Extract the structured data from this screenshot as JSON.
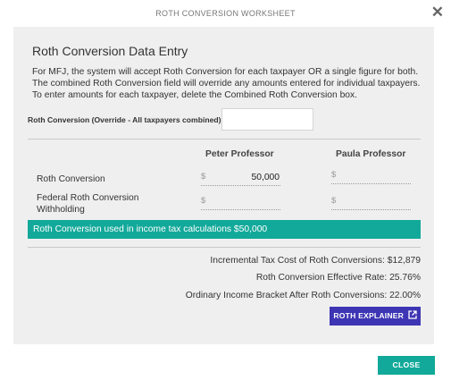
{
  "dialog": {
    "title": "ROTH CONVERSION WORKSHEET",
    "close_icon": "close-icon"
  },
  "panel": {
    "title": "Roth Conversion Data Entry",
    "description": "For MFJ, the system will accept Roth Conversion for each taxpayer OR a single figure for both. The combined Roth Conversion field will override any amounts entered for individual taxpayers. To enter amounts for each taxpayer, delete the Combined Roth Conversion box."
  },
  "override": {
    "label": "Roth Conversion (Override - All taxpayers combined)",
    "value": ""
  },
  "columns": {
    "taxpayer1": "Peter Professor",
    "taxpayer2": "Paula Professor"
  },
  "rows": [
    {
      "label": "Roth Conversion",
      "currency": "$",
      "taxpayer1_value": "50,000",
      "taxpayer2_value": ""
    },
    {
      "label": "Federal Roth Conversion Withholding",
      "currency": "$",
      "taxpayer1_value": "",
      "taxpayer2_value": ""
    }
  ],
  "banner": {
    "text": "Roth Conversion used in income tax calculations $50,000",
    "color": "#12a99a"
  },
  "summary": {
    "incremental_tax": "Incremental Tax Cost of Roth Conversions:  $12,879",
    "effective_rate": "Roth Conversion Effective Rate:  25.76%",
    "bracket": "Ordinary Income Bracket After Roth Conversions:  22.00%"
  },
  "buttons": {
    "explainer_label": "ROTH EXPLAINER",
    "explainer_icon": "external-link-icon",
    "explainer_color": "#3d35b3",
    "close_label": "CLOSE",
    "close_color": "#12a99a"
  }
}
